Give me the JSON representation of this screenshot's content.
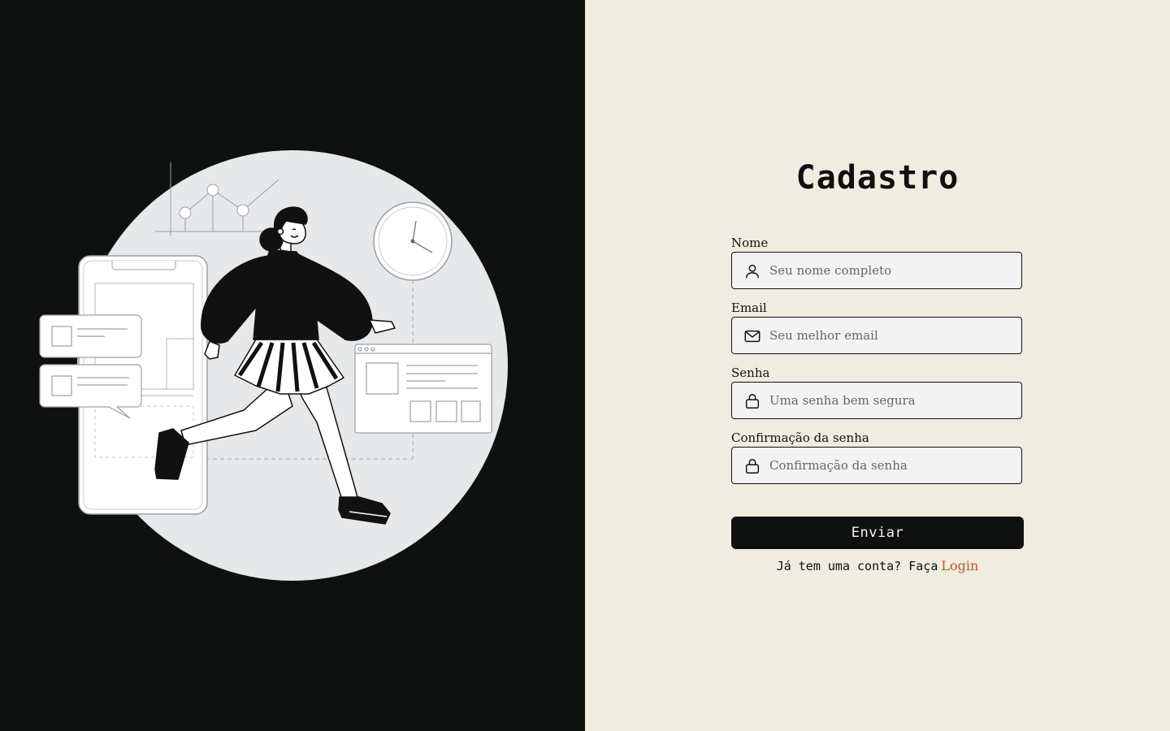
{
  "form": {
    "title": "Cadastro",
    "fields": [
      {
        "label": "Nome",
        "placeholder": "Seu nome completo",
        "icon": "user-icon"
      },
      {
        "label": "Email",
        "placeholder": "Seu melhor email",
        "icon": "mail-icon"
      },
      {
        "label": "Senha",
        "placeholder": "Uma senha bem segura",
        "icon": "lock-icon"
      },
      {
        "label": "Confirmação da senha",
        "placeholder": "Confirmação da senha",
        "icon": "lock-icon"
      }
    ],
    "submit_label": "Enviar",
    "footer_prompt": "Já tem uma conta? Faça",
    "footer_link": "Login"
  },
  "colors": {
    "left_bg": "#0f1010",
    "right_bg": "#efece0",
    "link": "#c0552a",
    "button_bg": "#0f1010"
  }
}
